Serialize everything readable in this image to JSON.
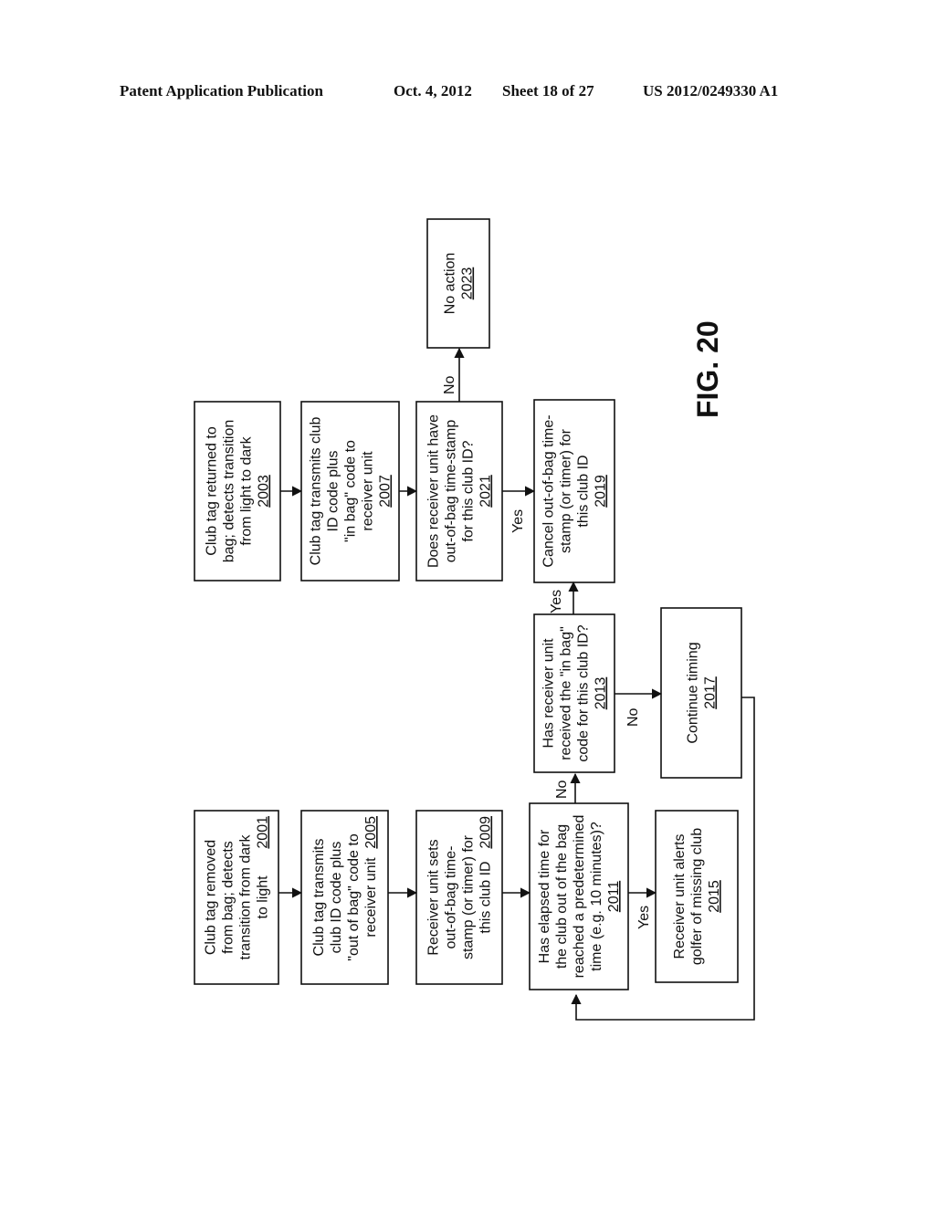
{
  "header": {
    "publication": "Patent Application Publication",
    "date": "Oct. 4, 2012",
    "sheet": "Sheet 18 of 27",
    "number": "US 2012/0249330 A1"
  },
  "figure_label": "FIG. 20",
  "boxes": [
    {
      "id": "2001",
      "lines": [
        "Club tag removed",
        "from bag; detects",
        "transition from dark",
        "to light"
      ],
      "ref": "2001"
    },
    {
      "id": "2005",
      "lines": [
        "Club tag transmits",
        "club ID code plus",
        "\"out of bag\" code to",
        "receiver unit"
      ],
      "ref": "2005"
    },
    {
      "id": "2009",
      "lines": [
        "Receiver unit sets",
        "out-of-bag time-",
        "stamp (or timer) for",
        "this club ID"
      ],
      "ref": "2009"
    },
    {
      "id": "2011",
      "lines": [
        "Has elapsed time for",
        "the club out of the bag",
        "reached a predetermined",
        "time (e.g. 10 minutes)?"
      ],
      "ref": "2011"
    },
    {
      "id": "2015",
      "lines": [
        "Receiver unit alerts",
        "golfer of missing club"
      ],
      "ref": "2015"
    },
    {
      "id": "2013",
      "lines": [
        "Has receiver unit",
        "received the \"in bag\"",
        "code for this club ID?"
      ],
      "ref": "2013"
    },
    {
      "id": "2017",
      "lines": [
        "Continue timing"
      ],
      "ref": "2017"
    },
    {
      "id": "2019",
      "lines": [
        "Cancel out-of-bag time-",
        "stamp (or timer) for",
        "this club ID"
      ],
      "ref": "2019"
    },
    {
      "id": "2003",
      "lines": [
        "Club tag returned to",
        "bag; detects transition",
        "from light to dark"
      ],
      "ref": "2003"
    },
    {
      "id": "2007",
      "lines": [
        "Club tag transmits club",
        "ID code plus",
        "\"in bag\" code to",
        "receiver unit"
      ],
      "ref": "2007"
    },
    {
      "id": "2021",
      "lines": [
        "Does receiver unit have",
        "out-of-bag time-stamp",
        "for this club ID?"
      ],
      "ref": "2021"
    },
    {
      "id": "2023",
      "lines": [
        "No action"
      ],
      "ref": "2023"
    }
  ],
  "edge_labels": {
    "e2011_2013": "No",
    "e2011_2015": "Yes",
    "e2013_2019": "Yes",
    "e2013_2017": "No",
    "e2021_2019": "Yes",
    "e2021_2023": "No"
  }
}
